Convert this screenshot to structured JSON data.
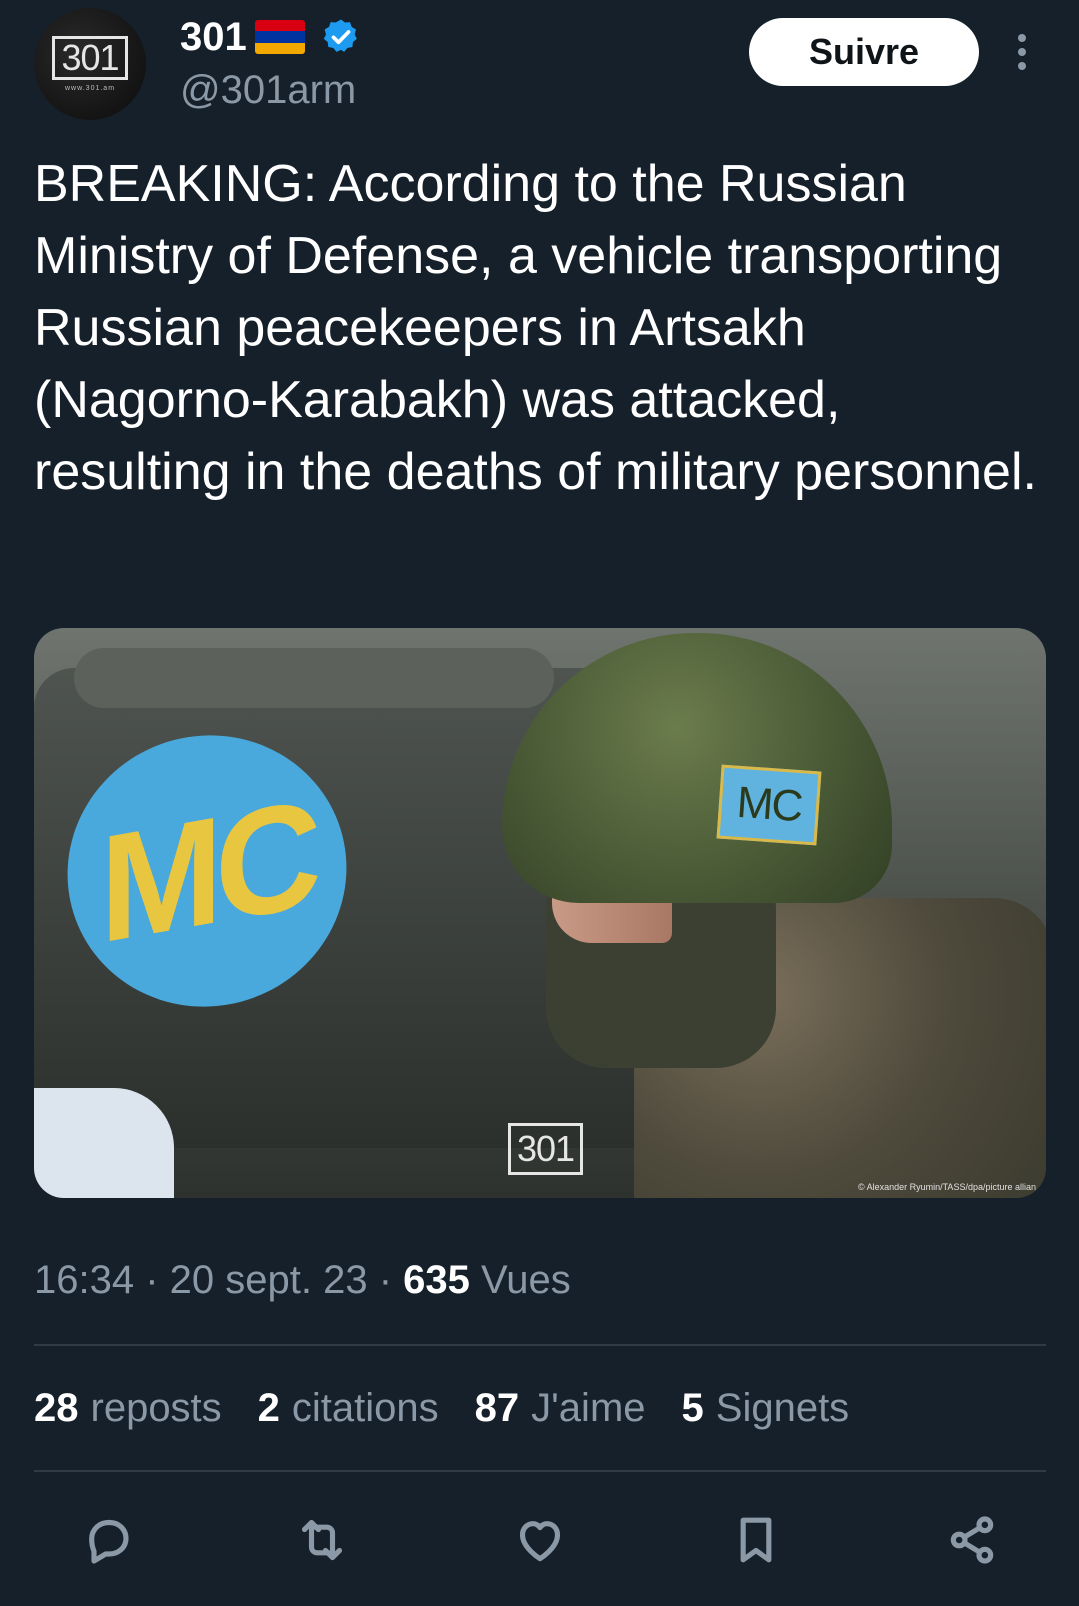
{
  "author": {
    "name": "301",
    "handle": "@301arm",
    "avatar_logo": "301",
    "avatar_sub": "www.301.am",
    "flag_colors": [
      "#d90012",
      "#0033a0",
      "#f2a800"
    ],
    "verified_color": "#1d9bf0"
  },
  "header": {
    "follow_label": "Suivre"
  },
  "tweet": {
    "text": "BREAKING: According to the Russian Ministry of Defense, a vehicle transporting Russian peacekeepers in Artsakh (Nagorno-Karabakh) was attacked, resulting in the deaths of military personnel."
  },
  "media": {
    "emblem_text": "MC",
    "patch_text": "MC",
    "watermark": "301",
    "credit": "© Alexander Ryumin/TASS/dpa/picture allian"
  },
  "meta": {
    "time": "16:34",
    "date": "20 sept. 23",
    "views_count": "635",
    "views_label": "Vues"
  },
  "stats": {
    "reposts_count": "28",
    "reposts_label": "reposts",
    "quotes_count": "2",
    "quotes_label": "citations",
    "likes_count": "87",
    "likes_label": "J'aime",
    "bookmarks_count": "5",
    "bookmarks_label": "Signets"
  },
  "actions": [
    "reply-icon",
    "repost-icon",
    "like-icon",
    "bookmark-icon",
    "share-icon"
  ]
}
